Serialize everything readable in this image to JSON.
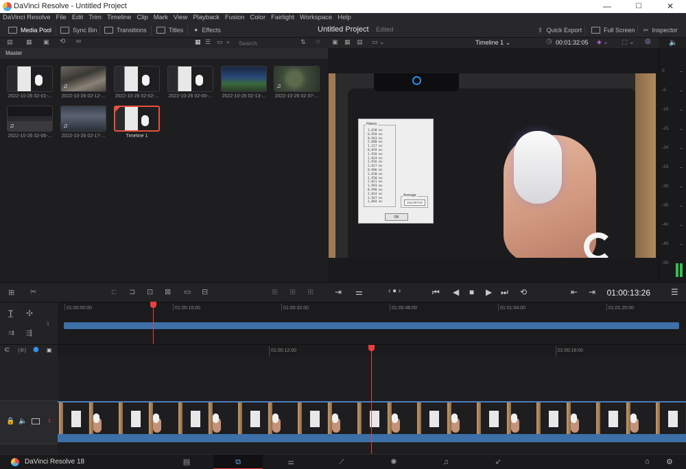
{
  "window": {
    "title": "DaVinci Resolve - Untitled Project",
    "min": "—",
    "max": "☐",
    "close": "✕"
  },
  "menu": [
    "DaVinci Resolve",
    "File",
    "Edit",
    "Trim",
    "Timeline",
    "Clip",
    "Mark",
    "View",
    "Playback",
    "Fusion",
    "Color",
    "Fairlight",
    "Workspace",
    "Help"
  ],
  "toolbar": {
    "media_pool": "Media Pool",
    "sync_bin": "Sync Bin",
    "transitions": "Transitions",
    "titles": "Titles",
    "effects": "Effects",
    "project_title": "Untitled Project",
    "project_status": "Edited",
    "quick_export": "Quick Export",
    "full_screen": "Full Screen",
    "inspector": "Inspector"
  },
  "media_pool": {
    "search_placeholder": "Search",
    "bin": "Master",
    "clips": [
      {
        "name": "2022-10-26 02-01-...",
        "thumb": "paper",
        "mouse": true,
        "music": false
      },
      {
        "name": "2022-10-26 02-12-...",
        "thumb": "game1",
        "mouse": false,
        "music": true
      },
      {
        "name": "2022-10-26 02-02-...",
        "thumb": "paper",
        "mouse": true,
        "music": false
      },
      {
        "name": "2022-10-26 02-00-...",
        "thumb": "paper",
        "mouse": true,
        "music": false
      },
      {
        "name": "2022-10-26 02-13-...",
        "thumb": "night",
        "mouse": false,
        "music": false
      },
      {
        "name": "2022-10-26 02-37-...",
        "thumb": "map",
        "mouse": false,
        "music": true
      },
      {
        "name": "2022-10-26 02-06-...",
        "thumb": "dark",
        "mouse": false,
        "music": true
      },
      {
        "name": "2022-10-26 02-17-...",
        "thumb": "storm",
        "mouse": false,
        "music": true
      },
      {
        "name": "Timeline 1",
        "thumb": "paper",
        "mouse": true,
        "music": false,
        "selected": true
      }
    ]
  },
  "viewer": {
    "timeline_name": "Timeline 1",
    "duration_tc": "00:01:32:05",
    "current_tc": "01:00:13:26",
    "dialog": {
      "history_label": "History",
      "history": [
        "1,030 ms",
        "0,958 ms",
        "0,963 ms",
        "2,008 ms",
        "1,217 ms",
        "0,859 ms",
        "1,958 ms",
        "1,024 ms",
        "1,926 ms",
        "2,027 ms",
        "0,986 ms",
        "2,030 ms",
        "1,950 ms",
        "2,021 ms",
        "1,993 ms",
        "0,990 ms",
        "2,054 ms",
        "1,947 ms",
        "1,004 ms"
      ],
      "average_label": "Average",
      "average_value": "818,0971M",
      "ok_label": "OK"
    }
  },
  "meter": {
    "scale": [
      "0",
      "-5",
      "-10",
      "-15",
      "-20",
      "-25",
      "-30",
      "-35",
      "-40",
      "-45",
      "-50"
    ],
    "level": 0.05
  },
  "upper_timeline": {
    "track_num": "1",
    "ruler": [
      "01:00:00:00",
      "01:00:16:00",
      "01:00:32:00",
      "01:00:48:00",
      "01:01:04:00",
      "01:01:20:00"
    ]
  },
  "lower_timeline": {
    "track_num": "1",
    "ruler": [
      "01:00:12:00",
      "01:00:16:00"
    ]
  },
  "pages": {
    "brand": "DaVinci Resolve 18",
    "items": [
      "media",
      "cut",
      "edit",
      "fusion",
      "color",
      "fairlight",
      "deliver"
    ],
    "active": "cut"
  },
  "colors": {
    "accent": "#e8413d",
    "track_blue": "#3d6fa8",
    "active_page": "#6aa4f0"
  }
}
